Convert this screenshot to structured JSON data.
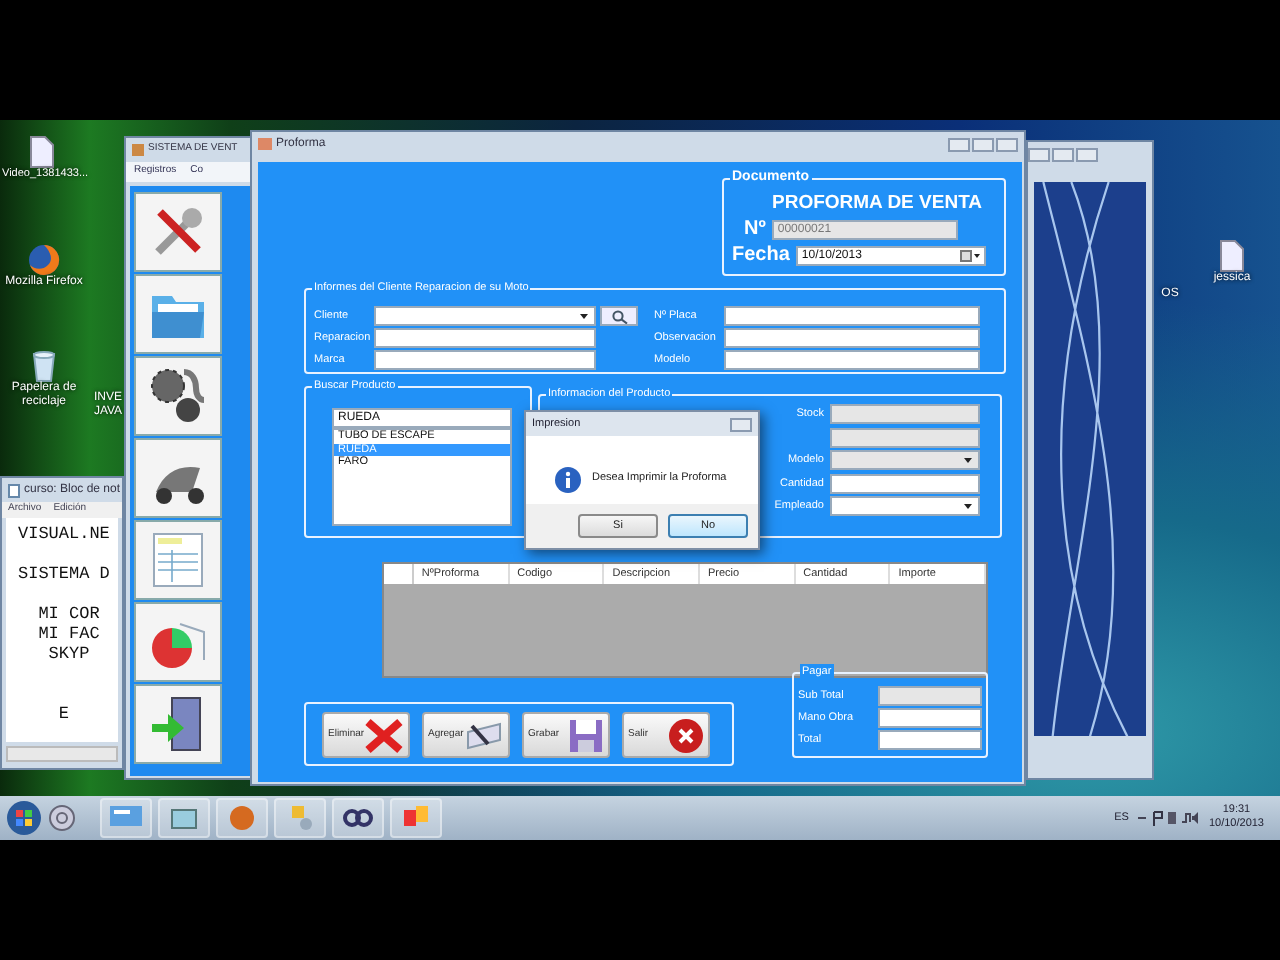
{
  "desktop_icons": [
    {
      "label": "Video_1381433...",
      "kind": "file"
    },
    {
      "label": "Mozilla Firefox",
      "kind": "browser"
    },
    {
      "label": "Papelera de reciclaje",
      "kind": "recycle"
    },
    {
      "label": "INVE JAVA",
      "kind": "label"
    },
    {
      "label": "OS",
      "kind": "label"
    },
    {
      "label": "jessica",
      "kind": "file"
    }
  ],
  "notepad": {
    "title": "curso: Bloc de not",
    "menu": [
      "Archivo",
      "Edición"
    ],
    "paragraphs": [
      [
        "VISUAL.NE"
      ],
      [
        "SISTEMA D"
      ],
      [
        "  MI COR",
        "  MI FAC",
        "   SKYP"
      ],
      [
        "    E"
      ]
    ]
  },
  "main_window": {
    "title": "SISTEMA DE VENT",
    "menu": [
      "Registros",
      "Co"
    ]
  },
  "proforma": {
    "title": "Proforma",
    "documento": {
      "legend": "Documento",
      "heading": "PROFORMA DE VENTA",
      "numero_label": "Nº",
      "numero": "00000021",
      "fecha_label": "Fecha",
      "fecha": "10/10/2013"
    },
    "cliente": {
      "legend": "Informes del Cliente Reparacion de su Moto",
      "left": [
        {
          "label": "Cliente",
          "kind": "combo"
        },
        {
          "label": "Reparacion",
          "kind": "text"
        },
        {
          "label": "Marca",
          "kind": "text"
        }
      ],
      "right": [
        {
          "label": "Nº Placa",
          "kind": "text"
        },
        {
          "label": "Observacion",
          "kind": "text"
        },
        {
          "label": "Modelo",
          "kind": "text"
        }
      ]
    },
    "buscar": {
      "legend": "Buscar Producto",
      "search_value": "RUEDA",
      "items": [
        {
          "label": "TUBO DE ESCAPE",
          "selected": false
        },
        {
          "label": "RUEDA",
          "selected": true
        },
        {
          "label": "FARO",
          "selected": false
        }
      ]
    },
    "producto": {
      "legend": "Informacion del  Producto",
      "fields": [
        {
          "label": "Stock",
          "kind": "readonly"
        },
        {
          "kind": "readonly"
        },
        {
          "label": "Modelo",
          "kind": "combo_disabled"
        },
        {
          "label": "Cantidad",
          "kind": "text"
        },
        {
          "label": "Empleado",
          "kind": "combo"
        }
      ]
    },
    "table": {
      "columns": [
        "NºProforma",
        "Codigo",
        "Descripcion",
        "Precio",
        "Cantidad",
        "Importe"
      ]
    },
    "buttons": [
      {
        "label": "Eliminar",
        "kind": "delete"
      },
      {
        "label": "Agregar",
        "kind": "add"
      },
      {
        "label": "Grabar",
        "kind": "save"
      },
      {
        "label": "Salir",
        "kind": "exit"
      }
    ],
    "pagar": {
      "legend": "Pagar",
      "fields": [
        {
          "label": "Sub Total",
          "kind": "readonly"
        },
        {
          "label": "Mano Obra",
          "kind": "text"
        },
        {
          "label": "Total",
          "kind": "text"
        }
      ]
    }
  },
  "dialog": {
    "title": "Impresion",
    "message": "Desea Imprimir la Proforma",
    "buttons": [
      {
        "label": "Si",
        "focused": false
      },
      {
        "label": "No",
        "focused": true
      }
    ]
  },
  "taskbar": {
    "language": "ES",
    "time": "19:31",
    "date": "10/10/2013"
  }
}
